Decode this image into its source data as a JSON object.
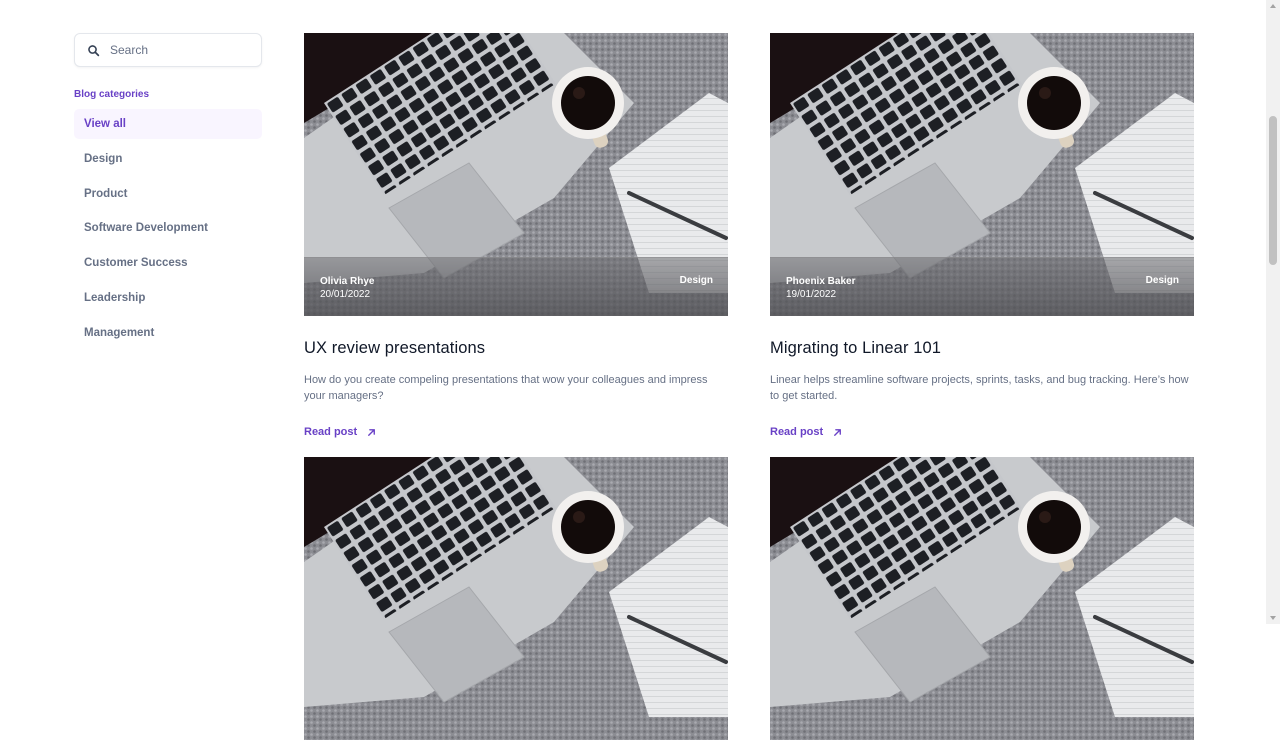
{
  "search": {
    "placeholder": "Search",
    "value": "",
    "icon": "search-icon"
  },
  "categories": {
    "title": "Blog categories",
    "items": [
      {
        "label": "View all",
        "active": true
      },
      {
        "label": "Design"
      },
      {
        "label": "Product"
      },
      {
        "label": "Software Development"
      },
      {
        "label": "Customer Success"
      },
      {
        "label": "Leadership"
      },
      {
        "label": "Management"
      }
    ]
  },
  "posts": [
    {
      "author": "Olivia Rhye",
      "date": "20/01/2022",
      "tag": "Design",
      "title": "UX review presentations",
      "description": "How do you create compeling presentations that wow your colleagues and impress your managers?",
      "link_label": "Read post",
      "link_icon": "arrow-up-right-icon"
    },
    {
      "author": "Phoenix Baker",
      "date": "19/01/2022",
      "tag": "Design",
      "title": "Migrating to Linear 101",
      "description": "Linear helps streamline software projects, sprints, tasks, and bug tracking. Here’s how to get started.",
      "link_label": "Read post",
      "link_icon": "arrow-up-right-icon"
    }
  ],
  "colors": {
    "accent": "#6941c6",
    "accent_bg": "#f9f5ff",
    "text_muted": "#667085",
    "heading": "#101828"
  }
}
